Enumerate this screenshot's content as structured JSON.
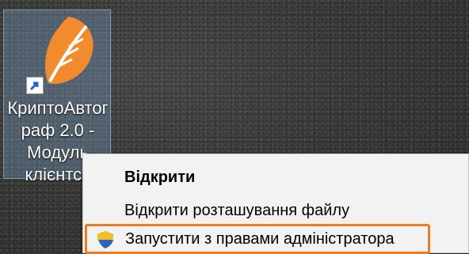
{
  "desktop": {
    "shortcut": {
      "label_lines": [
        "КриптоАвтог",
        "раф 2.0 -",
        "Модуль",
        "клієнтсь"
      ]
    }
  },
  "context_menu": {
    "items": [
      {
        "label": "Відкрити",
        "bold": true
      },
      {
        "label": "Відкрити розташування файлу",
        "bold": false
      },
      {
        "label": "Запустити з правами адміністратора",
        "bold": false,
        "highlighted": true,
        "icon": "uac-shield-icon"
      }
    ]
  },
  "colors": {
    "highlight_border": "#f07b1e",
    "logo_orange": "#f28a2e"
  }
}
